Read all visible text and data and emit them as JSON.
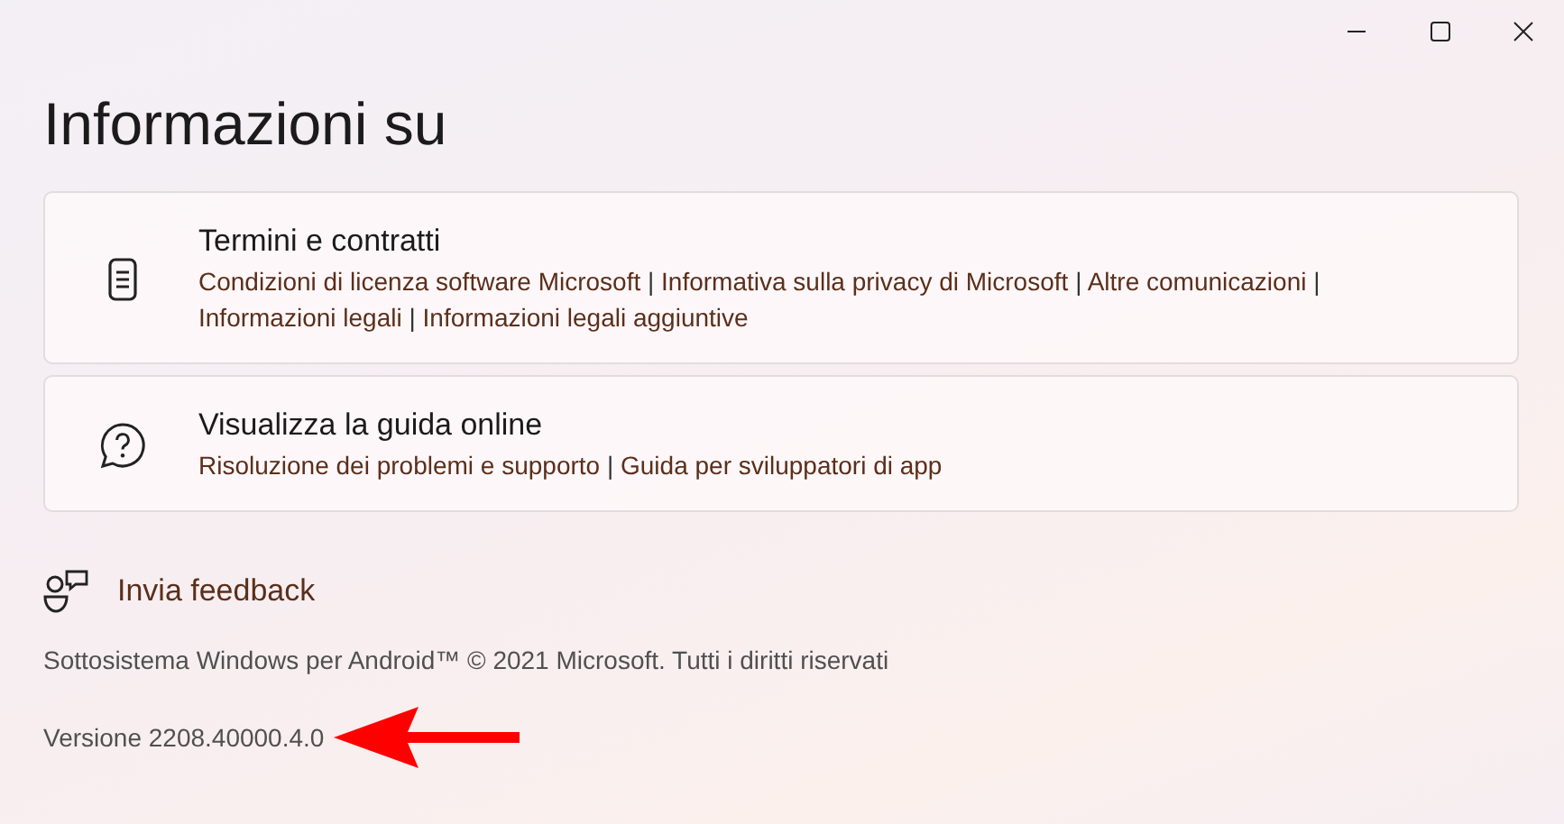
{
  "window": {
    "controls": [
      {
        "kind": "minimize"
      },
      {
        "kind": "maximize"
      },
      {
        "kind": "close"
      }
    ]
  },
  "title": "Informazioni su",
  "cards": [
    {
      "kind": "document",
      "heading": "Termini e contratti",
      "links": [
        "Condizioni di licenza software Microsoft",
        "Informativa sulla privacy di Microsoft",
        "Altre comunicazioni",
        "Informazioni legali",
        "Informazioni legali aggiuntive"
      ],
      "separator": "|"
    },
    {
      "kind": "help",
      "heading": "Visualizza la guida online",
      "links": [
        "Risoluzione dei problemi e supporto",
        "Guida per sviluppatori di app"
      ],
      "separator": "|"
    }
  ],
  "feedback": {
    "label": "Invia feedback"
  },
  "copyright": "Sottosistema Windows per Android™ © 2021 Microsoft. Tutti i diritti riservati",
  "version": "Versione 2208.40000.4.0"
}
